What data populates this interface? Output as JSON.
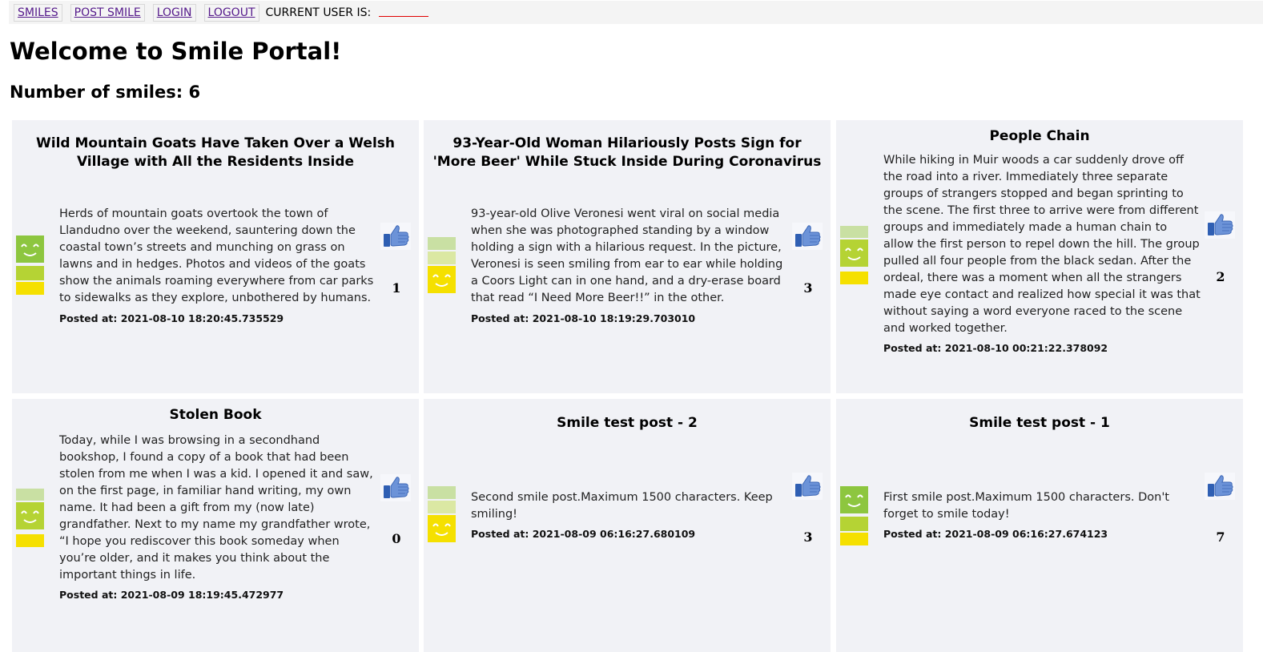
{
  "nav": {
    "items": [
      {
        "label": "SMILES"
      },
      {
        "label": "POST SMILE"
      },
      {
        "label": "LOGIN"
      },
      {
        "label": "LOGOUT"
      }
    ],
    "current_user_label": "CURRENT USER IS:",
    "current_user_value": ""
  },
  "page": {
    "title": "Welcome to Smile Portal!",
    "count_text": "Number of smiles: 6"
  },
  "colors": {
    "card_bg": "#f1f2f6",
    "mood_green_dark": "#8dc63f",
    "mood_green_mid": "#b5d334",
    "mood_green_light": "#c9e0a3",
    "mood_lime_light": "#dbe8a3",
    "mood_yellow": "#f5e000",
    "link": "#551a8b",
    "user_underline": "#e00000"
  },
  "smiles": [
    {
      "title": "Wild Mountain Goats Have Taken Over a Welsh Village with All the Residents Inside",
      "text": "Herds of mountain goats overtook the town of Llandudno over the weekend, sauntering down the coastal town’s streets and munching on grass on lawns and in hedges. Photos and videos of the goats show the animals roaming everywhere from car parks to sidewalks as they explore, unbothered by humans.",
      "posted": "Posted at: 2021-08-10 18:20:45.735529",
      "likes": "1",
      "mood_level": 3
    },
    {
      "title": "93-Year-Old Woman Hilariously Posts Sign for 'More Beer' While Stuck Inside During Coronavirus",
      "text": "93-year-old Olive Veronesi went viral on social media when she was photographed standing by a window holding a sign with a hilarious request. In the picture, Veronesi is seen smiling from ear to ear while holding a Coors Light can in one hand, and a dry-erase board that read “I Need More Beer!!” in the other.",
      "posted": "Posted at: 2021-08-10 18:19:29.703010",
      "likes": "3",
      "mood_level": 1
    },
    {
      "title": "People Chain",
      "text": "While hiking in Muir woods a car suddenly drove off the road into a river. Immediately three separate groups of strangers stopped and began sprinting to the scene. The first three to arrive were from different groups and immediately made a human chain to allow the first person to repel down the hill. The group pulled all four people from the black sedan. After the ordeal, there was a moment when all the strangers made eye contact and realized how special it was that without saying a word everyone raced to the scene and worked together.",
      "posted": "Posted at: 2021-08-10 00:21:22.378092",
      "likes": "2",
      "mood_level": 2
    },
    {
      "title": "Stolen Book",
      "text": "Today, while I was browsing in a secondhand bookshop, I found a copy of a book that had been stolen from me when I was a kid. I opened it and saw, on the first page, in familiar hand writing, my own name. It had been a gift from my (now late) grandfather. Next to my name my grandfather wrote, “I hope you rediscover this book someday when you’re older, and it makes you think about the important things in life.",
      "posted": "Posted at: 2021-08-09 18:19:45.472977",
      "likes": "0",
      "mood_level": 2
    },
    {
      "title": "Smile test post - 2",
      "text": "Second smile post.Maximum 1500 characters. Keep smiling!",
      "posted": "Posted at: 2021-08-09 06:16:27.680109",
      "likes": "3",
      "mood_level": 1
    },
    {
      "title": "Smile test post - 1",
      "text": "First smile post.Maximum 1500 characters. Don't forget to smile today!",
      "posted": "Posted at: 2021-08-09 06:16:27.674123",
      "likes": "7",
      "mood_level": 3
    }
  ]
}
